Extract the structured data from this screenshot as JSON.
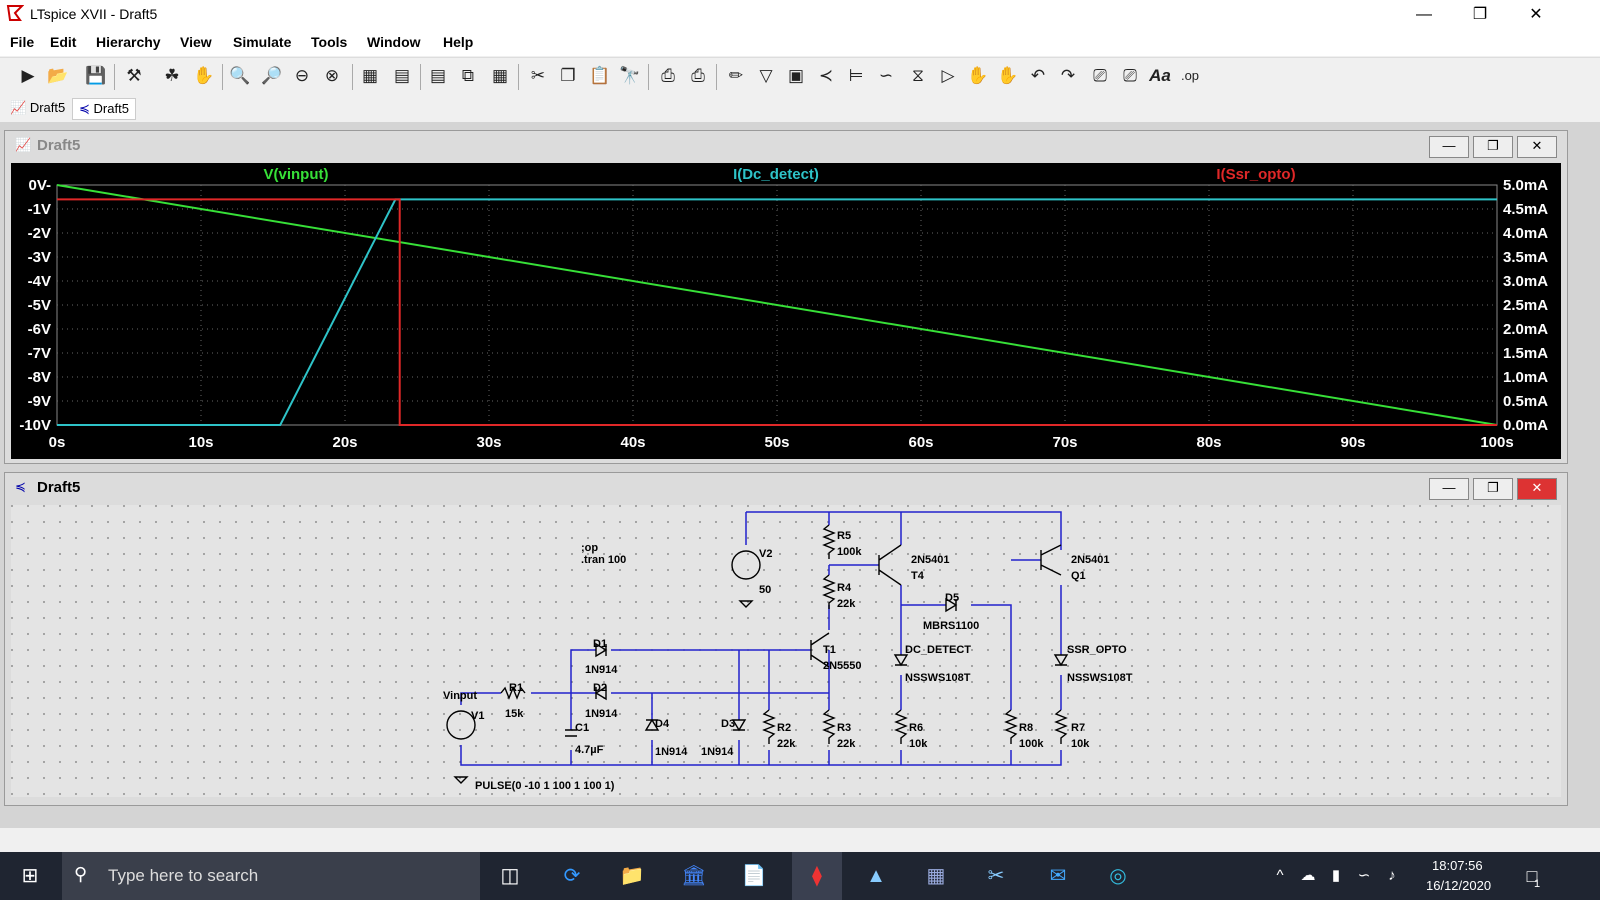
{
  "app": {
    "title": "LTspice XVII - Draft5"
  },
  "menu": [
    "File",
    "Edit",
    "Hierarchy",
    "View",
    "Simulate",
    "Tools",
    "Window",
    "Help"
  ],
  "tabs": [
    {
      "label": "Draft5"
    },
    {
      "label": "Draft5"
    }
  ],
  "waveform_window": {
    "title": "Draft5",
    "traces": [
      {
        "name": "V(vinput)",
        "color": "#37e038"
      },
      {
        "name": "I(Dc_detect)",
        "color": "#2ec3c8"
      },
      {
        "name": "I(Ssr_opto)",
        "color": "#e02828"
      }
    ],
    "left_ticks": [
      "0V-",
      "-1V",
      "-2V",
      "-3V",
      "-4V",
      "-5V",
      "-6V",
      "-7V",
      "-8V",
      "-9V",
      "-10V"
    ],
    "right_ticks": [
      "5.0mA",
      "4.5mA",
      "4.0mA",
      "3.5mA",
      "3.0mA",
      "2.5mA",
      "2.0mA",
      "1.5mA",
      "1.0mA",
      "0.5mA",
      "0.0mA"
    ],
    "x_ticks": [
      "0s",
      "10s",
      "20s",
      "30s",
      "40s",
      "50s",
      "60s",
      "70s",
      "80s",
      "90s",
      "100s"
    ]
  },
  "chart_data": {
    "type": "line",
    "x_label": "",
    "xlim": [
      0,
      100
    ],
    "y_left_lim": [
      -10,
      0
    ],
    "y_right_lim": [
      0,
      5
    ],
    "grid": true,
    "legend_placement": "top",
    "series": [
      {
        "name": "V(vinput)",
        "axis": "left",
        "x": [
          0,
          100
        ],
        "y": [
          0,
          -10
        ]
      },
      {
        "name": "I(Dc_detect)",
        "axis": "right",
        "x": [
          0,
          15.5,
          23.5,
          24.2,
          100
        ],
        "y": [
          0,
          0,
          4.7,
          4.7,
          4.7
        ]
      },
      {
        "name": "I(Ssr_opto)",
        "axis": "right",
        "x": [
          0,
          23.8,
          23.8,
          100
        ],
        "y": [
          4.7,
          4.7,
          0,
          0
        ]
      }
    ]
  },
  "schematic_window": {
    "title": "Draft5",
    "directives": [
      ";op",
      ".tran 100"
    ],
    "labels": {
      "vinput": "Vinput",
      "v1": "V1",
      "pulse": "PULSE(0 -10 1 100 1 100 1)",
      "r1": "R1",
      "r1v": "15k",
      "c1": "C1",
      "c1v": "4.7µF",
      "d1": "D1",
      "d1v": "1N914",
      "d2": "D2",
      "d2v": "1N914",
      "d3": "D3",
      "d3v": "1N914",
      "d4": "D4",
      "d4v": "1N914",
      "r2": "R2",
      "r2v": "22k",
      "r3": "R3",
      "r3v": "22k",
      "r4": "R4",
      "r4v": "22k",
      "r5": "R5",
      "r5v": "100k",
      "t1": "T1",
      "t1v": "2N5550",
      "t4": "T4",
      "t4v": "2N5401",
      "v2": "V2",
      "v2v": "50",
      "d5": "D5",
      "d5v": "MBRS1100",
      "dcd": "DC_DETECT",
      "dcdv": "NSSWS108T",
      "r6": "R6",
      "r6v": "10k",
      "q1": "Q1",
      "q1v": "2N5401",
      "ssr": "SSR_OPTO",
      "ssrv": "NSSWS108T",
      "r8": "R8",
      "r8v": "100k",
      "r7": "R7",
      "r7v": "10k"
    }
  },
  "taskbar": {
    "search_placeholder": "Type here to search",
    "time": "18:07:56",
    "date": "16/12/2020",
    "notifications": "1"
  }
}
